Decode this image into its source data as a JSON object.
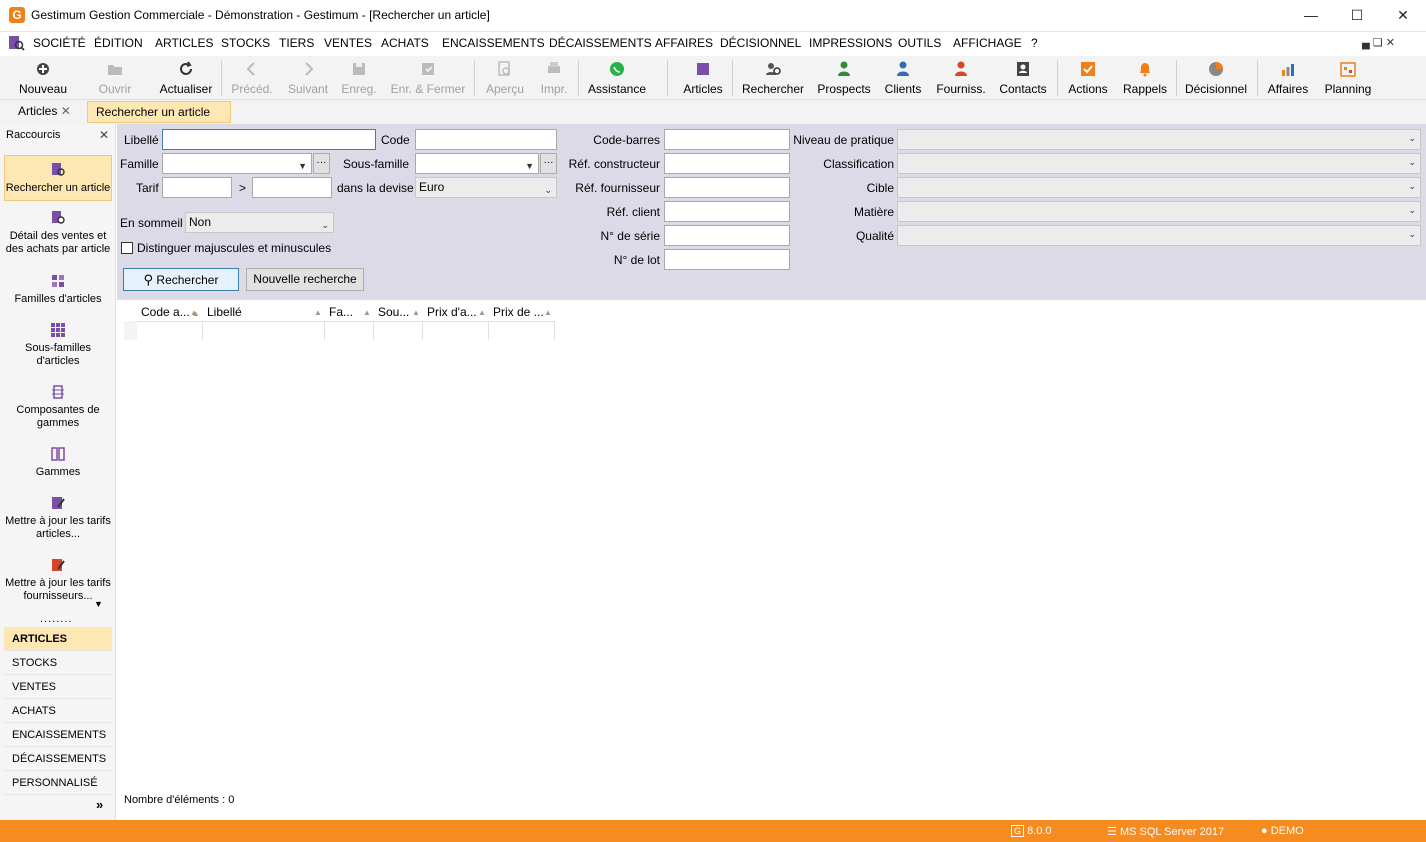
{
  "window": {
    "title": "Gestimum Gestion Commerciale - Démonstration - Gestimum - [Rechercher un article]",
    "logo": "G"
  },
  "menu": [
    "SOCIÉTÉ",
    "ÉDITION",
    "ARTICLES",
    "STOCKS",
    "TIERS",
    "VENTES",
    "ACHATS",
    "ENCAISSEMENTS",
    "DÉCAISSEMENTS",
    "AFFAIRES",
    "DÉCISIONNEL",
    "IMPRESSIONS",
    "OUTILS",
    "AFFICHAGE",
    "?"
  ],
  "toolbar": {
    "nouveau": "Nouveau",
    "ouvrir": "Ouvrir",
    "actualiser": "Actualiser",
    "preced": "Précéd.",
    "suivant": "Suivant",
    "enreg": "Enreg.",
    "enr_fermer": "Enr. & Fermer",
    "apercu": "Aperçu",
    "impr": "Impr.",
    "assistance": "Assistance",
    "articles": "Articles",
    "rechercher": "Rechercher",
    "prospects": "Prospects",
    "clients": "Clients",
    "fourniss": "Fourniss.",
    "contacts": "Contacts",
    "actions": "Actions",
    "rappels": "Rappels",
    "decisionnel": "Décisionnel",
    "affaires": "Affaires",
    "planning": "Planning"
  },
  "tabs": [
    {
      "label": "Articles"
    },
    {
      "label": "Rechercher un article"
    }
  ],
  "sidebar": {
    "title": "Raccourcis",
    "shortcuts": [
      "Rechercher un article",
      "Détail des ventes et des achats par article",
      "Familles d'articles",
      "Sous-familles d'articles",
      "Composantes de gammes",
      "Gammes",
      "Mettre à jour les tarifs articles...",
      "Mettre à jour les tarifs fournisseurs..."
    ],
    "sections": [
      "ARTICLES",
      "STOCKS",
      "VENTES",
      "ACHATS",
      "ENCAISSEMENTS",
      "DÉCAISSEMENTS",
      "PERSONNALISÉ"
    ],
    "dots": "........",
    "more": "»"
  },
  "form": {
    "libelle": "Libellé",
    "code": "Code",
    "famille": "Famille",
    "sous_famille": "Sous-famille",
    "tarif": "Tarif",
    "gt": ">",
    "dans_devise": "dans la devise",
    "devise_value": "Euro",
    "en_sommeil": "En sommeil",
    "en_sommeil_value": "Non",
    "distinguer": "Distinguer majuscules et minuscules",
    "rechercher_btn": "Rechercher",
    "nouvelle_btn": "Nouvelle recherche",
    "ellipsis": "···",
    "code_barres": "Code-barres",
    "ref_constructeur": "Réf. constructeur",
    "ref_fournisseur": "Réf. fournisseur",
    "ref_client": "Réf. client",
    "num_serie": "N° de série",
    "num_lot": "N° de lot",
    "niveau": "Niveau de pratique",
    "classification": "Classification",
    "cible": "Cible",
    "matiere": "Matière",
    "qualite": "Qualité"
  },
  "grid": {
    "columns": [
      "Code a...",
      "Libellé",
      "Fa...",
      "Sou...",
      "Prix d'a...",
      "Prix de ..."
    ],
    "count_label": "Nombre d'éléments : 0"
  },
  "status": {
    "version": "8.0.0",
    "server": "MS SQL Server 2017",
    "user": "DEMO"
  },
  "colors": {
    "accent": "#f68b1f",
    "selected": "#fde8b4",
    "panel": "#dcdae6"
  }
}
